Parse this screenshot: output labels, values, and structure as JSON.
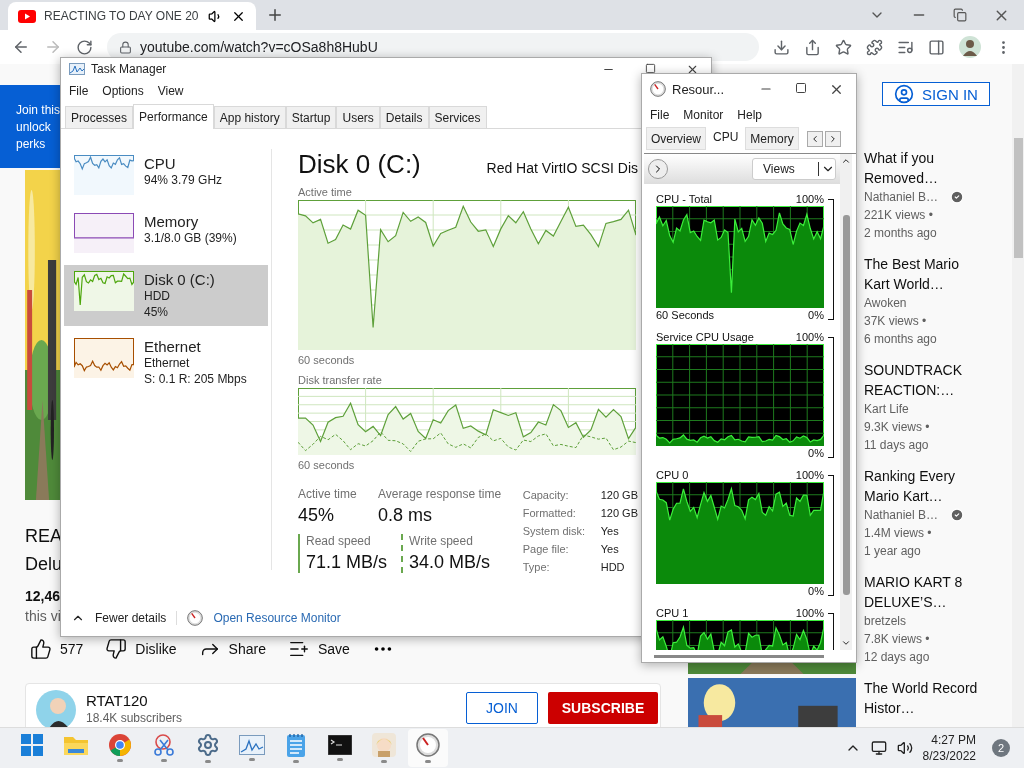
{
  "browser": {
    "tab_title": "REACTING TO DAY ONE 20",
    "url": "youtube.com/watch?v=cOSa8h8HubU"
  },
  "youtube": {
    "banner_lines": [
      "Join this",
      "unlock",
      "perks"
    ],
    "video_title_lines": [
      "REA",
      "Delu"
    ],
    "views": "12,46",
    "description": "this vi",
    "likes": "577",
    "actions": [
      {
        "kind": "dislike",
        "label": "Dislike"
      },
      {
        "kind": "share",
        "label": "Share"
      },
      {
        "kind": "save",
        "label": "Save"
      }
    ],
    "channel": {
      "name": "RTAT120",
      "subscribers": "18.4K subscribers",
      "join": "JOIN",
      "subscribe": "SUBSCRIBE"
    },
    "sign_in": "SIGN IN",
    "recommendations": [
      {
        "title": "What if you Removed…",
        "channel": "Nathaniel B…",
        "verified": true,
        "views": "221K views •",
        "age": "2 months ago",
        "thumbnail": false
      },
      {
        "title": "The Best Mario Kart World…",
        "channel": "Awoken",
        "verified": false,
        "views": "37K views •",
        "age": "6 months ago",
        "thumbnail": false
      },
      {
        "title": "SOUNDTRACK REACTION:…",
        "channel": "Kart Life",
        "verified": false,
        "views": "9.3K views •",
        "age": "11 days ago",
        "thumbnail": false
      },
      {
        "title": "Ranking Every Mario Kart…",
        "channel": "Nathaniel B…",
        "verified": true,
        "views": "1.4M views •",
        "age": "1 year ago",
        "thumbnail": false
      },
      {
        "title": "MARIO KART 8 DELUXE’S…",
        "channel": "bretzels",
        "verified": false,
        "views": "7.8K views •",
        "age": "12 days ago",
        "thumbnail": true
      },
      {
        "title": "The World Record Histor…",
        "thumbnail": true
      }
    ]
  },
  "task_manager": {
    "title": "Task Manager",
    "menu": [
      "File",
      "Options",
      "View"
    ],
    "tabs": [
      {
        "label": "Processes",
        "selected": false
      },
      {
        "label": "Performance",
        "selected": true
      },
      {
        "label": "App history",
        "selected": false
      },
      {
        "label": "Startup",
        "selected": false
      },
      {
        "label": "Users",
        "selected": false
      },
      {
        "label": "Details",
        "selected": false
      },
      {
        "label": "Services",
        "selected": false
      }
    ],
    "resources": [
      {
        "kind": "cpu",
        "name": "CPU",
        "details": [
          "94%  3.79 GHz"
        ],
        "selected": false
      },
      {
        "kind": "memory",
        "name": "Memory",
        "details": [
          "3.1/8.0 GB (39%)"
        ],
        "selected": false
      },
      {
        "kind": "disk",
        "name": "Disk 0 (C:)",
        "details": [
          "HDD",
          "45%"
        ],
        "selected": true
      },
      {
        "kind": "ethernet",
        "name": "Ethernet",
        "details": [
          "Ethernet",
          "S: 0.1 R: 205 Mbps"
        ],
        "selected": false
      }
    ],
    "heading": "Disk 0 (C:)",
    "model": "Red Hat VirtIO SCSI Dis",
    "graphs": [
      {
        "kind": "active",
        "label": "Active time",
        "span": "60 seconds"
      },
      {
        "kind": "transfer",
        "label": "Disk transfer rate",
        "span": "60 seconds"
      }
    ],
    "stats": [
      {
        "label": "Active time",
        "value": "45%"
      },
      {
        "label": "Average response time",
        "value": "0.8 ms"
      }
    ],
    "speeds": [
      {
        "kind": "read",
        "label": "Read speed",
        "value": "71.1 MB/s"
      },
      {
        "kind": "write",
        "label": "Write speed",
        "value": "34.0 MB/s"
      }
    ],
    "properties": [
      {
        "label": "Capacity:",
        "value": "120 GB"
      },
      {
        "label": "Formatted:",
        "value": "120 GB"
      },
      {
        "label": "System disk:",
        "value": "Yes"
      },
      {
        "label": "Page file:",
        "value": "Yes"
      },
      {
        "label": "Type:",
        "value": "HDD"
      }
    ],
    "fewer_details": "Fewer details",
    "open_resource_monitor": "Open Resource Monitor"
  },
  "resource_monitor": {
    "title": "Resour...",
    "menu": [
      "File",
      "Monitor",
      "Help"
    ],
    "tabs": [
      {
        "label": "Overview",
        "selected": false
      },
      {
        "label": "CPU",
        "selected": true
      },
      {
        "label": "Memory",
        "selected": false
      }
    ],
    "views": "Views",
    "graphs": [
      {
        "kind": "total",
        "title": "CPU - Total",
        "max": "100%",
        "span": "60 Seconds",
        "min": "0%"
      },
      {
        "kind": "service",
        "title": "Service CPU Usage",
        "max": "100%",
        "min": "0%"
      },
      {
        "kind": "core",
        "title": "CPU 0",
        "max": "100%",
        "min": "0%"
      },
      {
        "kind": "core",
        "title": "CPU 1",
        "max": "100%"
      }
    ]
  },
  "taskbar": {
    "apps": [
      {
        "kind": "start",
        "running": false,
        "active": false
      },
      {
        "kind": "files",
        "running": false,
        "active": false
      },
      {
        "kind": "chrome",
        "running": true,
        "active": false
      },
      {
        "kind": "snip",
        "running": true,
        "active": false
      },
      {
        "kind": "settings",
        "running": true,
        "active": false
      },
      {
        "kind": "taskmgr",
        "running": true,
        "active": false
      },
      {
        "kind": "notepad",
        "running": true,
        "active": false
      },
      {
        "kind": "terminal",
        "running": true,
        "active": false
      },
      {
        "kind": "avatar",
        "running": true,
        "active": false
      },
      {
        "kind": "resmon",
        "running": true,
        "active": true
      }
    ],
    "time": "4:27 PM",
    "date": "8/23/2022",
    "notifications": "2"
  }
}
